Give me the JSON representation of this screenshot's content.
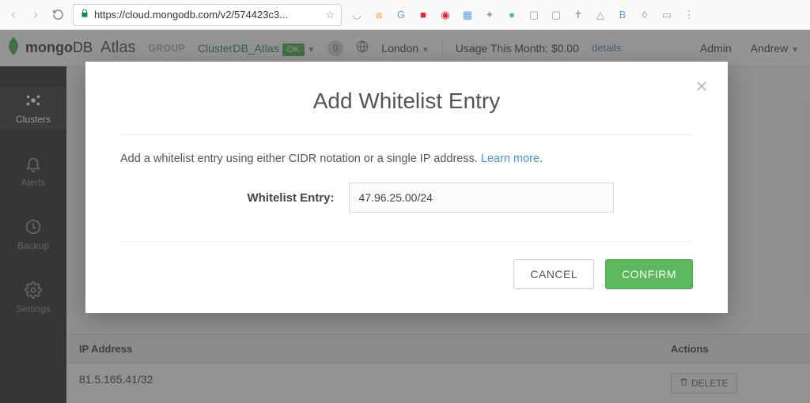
{
  "browser": {
    "url_display": "https://cloud.mongodb.com/v2/574423c3...",
    "scheme_prefix": "https"
  },
  "header": {
    "brand_bold": "mongo",
    "brand_light": "DB",
    "brand_atlas": "Atlas",
    "group_label": "GROUP",
    "group_name": "ClusterDB_Atlas",
    "status_badge": "OK",
    "notif_count": "0",
    "region": "London",
    "usage_label": "Usage This Month: $0.00",
    "usage_link": "details",
    "admin": "Admin",
    "user": "Andrew"
  },
  "sidebar": {
    "items": [
      {
        "label": "Clusters"
      },
      {
        "label": "Alerts"
      },
      {
        "label": "Backup"
      },
      {
        "label": "Settings"
      }
    ]
  },
  "table": {
    "cols": {
      "ip": "IP Address",
      "actions": "Actions"
    },
    "rows": [
      {
        "ip": "81.5.165.41/32"
      }
    ],
    "delete_label": "DELETE"
  },
  "modal": {
    "title": "Add Whitelist Entry",
    "desc": "Add a whitelist entry using either CIDR notation or a single IP address. ",
    "learn_more": "Learn more",
    "form_label": "Whitelist Entry:",
    "input_value": "47.96.25.00/24",
    "cancel": "CANCEL",
    "confirm": "CONFIRM"
  }
}
